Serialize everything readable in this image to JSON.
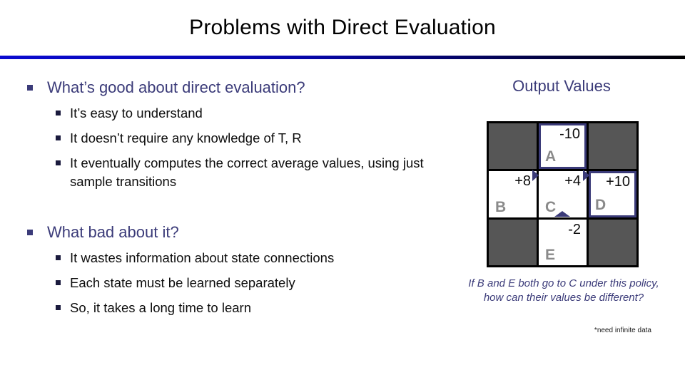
{
  "slide": {
    "title": "Problems with Direct Evaluation"
  },
  "content": {
    "groups": [
      {
        "heading": "What’s good about direct evaluation?",
        "items": [
          "It’s easy to understand",
          "It doesn’t require any knowledge of T, R",
          "It eventually computes the correct average values, using just sample transitions"
        ]
      },
      {
        "heading": "What bad about it?",
        "items": [
          "It wastes information about state connections",
          "Each state must be learned separately",
          "So, it takes a long time to learn"
        ]
      }
    ]
  },
  "panel": {
    "heading": "Output Values",
    "caption": "If B and E both go to C under this policy, how can their values be different?",
    "footnote": "*need infinite data"
  },
  "grid": {
    "rows": 3,
    "cols": 3,
    "cells": [
      {
        "type": "blocked",
        "name": "",
        "value": ""
      },
      {
        "type": "terminal",
        "name": "A",
        "value": "-10"
      },
      {
        "type": "blocked",
        "name": "",
        "value": ""
      },
      {
        "type": "open",
        "name": "B",
        "value": "+8"
      },
      {
        "type": "open",
        "name": "C",
        "value": "+4"
      },
      {
        "type": "terminal",
        "name": "D",
        "value": "+10"
      },
      {
        "type": "blocked",
        "name": "",
        "value": ""
      },
      {
        "type": "open",
        "name": "E",
        "value": "-2"
      },
      {
        "type": "blocked",
        "name": "",
        "value": ""
      }
    ],
    "arrows": [
      {
        "from": "B",
        "to": "C",
        "direction": "right"
      },
      {
        "from": "C",
        "to": "D",
        "direction": "right"
      },
      {
        "from": "E",
        "to": "C",
        "direction": "up"
      }
    ]
  },
  "colors": {
    "accent_navy": "#3b3b79",
    "blocked_gray": "#565656",
    "label_gray": "#8a8a8a",
    "rule_blue": "#0a0ad0"
  }
}
